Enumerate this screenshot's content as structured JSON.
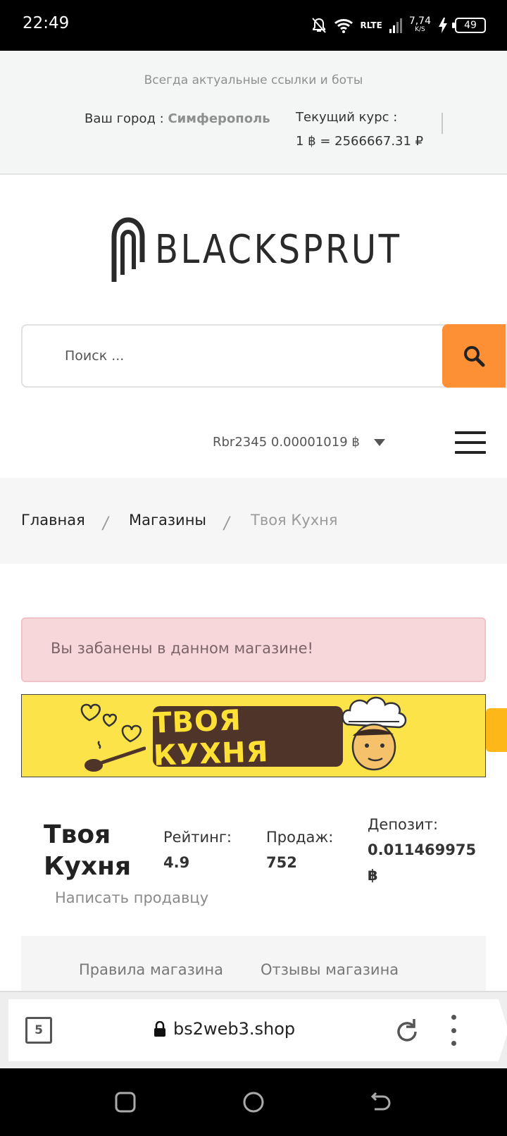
{
  "status_bar": {
    "time": "22:49",
    "network_type": "RLTE",
    "speed_value": "7,74",
    "speed_unit": "K/S",
    "battery": "49"
  },
  "top_info": {
    "tagline": "Всегда актуальные ссылки и боты",
    "city_label": "Ваш город :",
    "city_value": "Симферополь",
    "rate_label": "Текущий курс :",
    "rate_value": "1 ฿ = 2566667.31 ₽"
  },
  "logo": {
    "text": "BLACKSPRUT"
  },
  "search": {
    "placeholder": "Поиск ..."
  },
  "account": {
    "text": "Rbr2345 0.00001019 ฿"
  },
  "breadcrumb": {
    "items": [
      "Главная",
      "Магазины",
      "Твоя Кухня"
    ],
    "separator": "/"
  },
  "alert": {
    "text": "Вы забанены в данном магазине!"
  },
  "banner": {
    "text": "ТВОЯ КУХНЯ",
    "bg_color": "#fbe349",
    "box_color": "#4e3429",
    "text_color": "#ffe135"
  },
  "shop": {
    "name_line1": "Твоя",
    "name_line2": "Кухня",
    "rating_label": "Рейтинг:",
    "rating_value": "4.9",
    "sales_label": "Продаж:",
    "sales_value": "752",
    "deposit_label": "Депозит:",
    "deposit_value": "0.011469975",
    "deposit_currency": "฿",
    "write_seller": "Написать продавцу"
  },
  "tabs": [
    "Правила магазина",
    "Отзывы магазина"
  ],
  "browser": {
    "tab_count": "5",
    "url": "bs2web3.shop"
  },
  "colors": {
    "accent": "#fd8f34",
    "alert_bg": "#f8d7da"
  }
}
